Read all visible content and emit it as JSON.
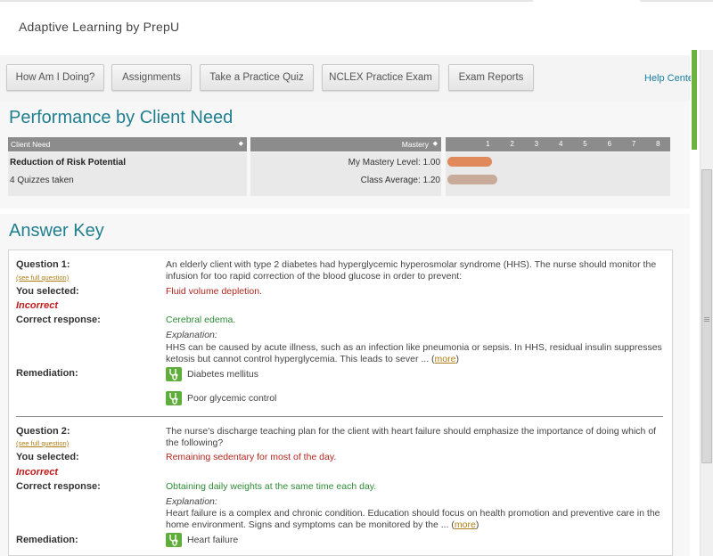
{
  "app": {
    "title": "Adaptive Learning by PrepU"
  },
  "nav": {
    "items": [
      {
        "label": "How Am I Doing?"
      },
      {
        "label": "Assignments"
      },
      {
        "label": "Take a Practice Quiz"
      },
      {
        "label": "NCLEX Practice Exam"
      },
      {
        "label": "Exam Reports"
      }
    ],
    "help": "Help Center"
  },
  "performance": {
    "title": "Performance by Client Need",
    "headers": {
      "client_need": "Client Need",
      "mastery": "Mastery"
    },
    "scale_ticks": [
      "1",
      "2",
      "3",
      "4",
      "5",
      "6",
      "7",
      "8"
    ],
    "row": {
      "need": "Reduction of Risk Potential",
      "quizzes": "4 Quizzes taken",
      "my_mastery": "My Mastery Level: 1.00",
      "class_avg": "Class Average: 1.20"
    },
    "chart_data": {
      "type": "bar",
      "categories": [
        "My Mastery Level",
        "Class Average"
      ],
      "values": [
        1.0,
        1.2
      ],
      "xlim": [
        0,
        8
      ],
      "colors": [
        "#e0895a",
        "#c8ab98"
      ]
    }
  },
  "answer_key": {
    "title": "Answer Key",
    "labels": {
      "selected": "You selected:",
      "incorrect": "Incorrect",
      "correct": "Correct response:",
      "explanation": "Explanation:",
      "remediation": "Remediation:",
      "see_full": "(see full question)",
      "more": "more"
    },
    "questions": [
      {
        "label": "Question 1:",
        "text": "An elderly client with type 2 diabetes had hyperglycemic hyperosmolar syndrome (HHS). The nurse should monitor the infusion for too rapid correction of the blood glucose in order to prevent:",
        "selected": "Fluid volume depletion.",
        "correct": "Cerebral edema.",
        "explanation": "HHS can be caused by acute illness, such as an infection like pneumonia or sepsis. In HHS, residual insulin suppresses ketosis but cannot control hyperglycemia. This leads to sever ...",
        "remediation": [
          "Diabetes mellitus",
          "Poor glycemic control"
        ]
      },
      {
        "label": "Question 2:",
        "text": "The nurse's discharge teaching plan for the client with heart failure should emphasize the importance of doing which of the following?",
        "selected": "Remaining sedentary for most of the day.",
        "correct": "Obtaining daily weights at the same time each day.",
        "explanation": "Heart failure is a complex and chronic condition. Education should focus on health promotion and preventive care in the home environment. Signs and symptoms can be monitored by the ...",
        "remediation": [
          "Heart failure"
        ]
      }
    ]
  },
  "colors": {
    "accent": "#1f7f8f",
    "green": "#6db33f",
    "incorrect": "#c21a1a",
    "correct": "#2e8a35"
  }
}
